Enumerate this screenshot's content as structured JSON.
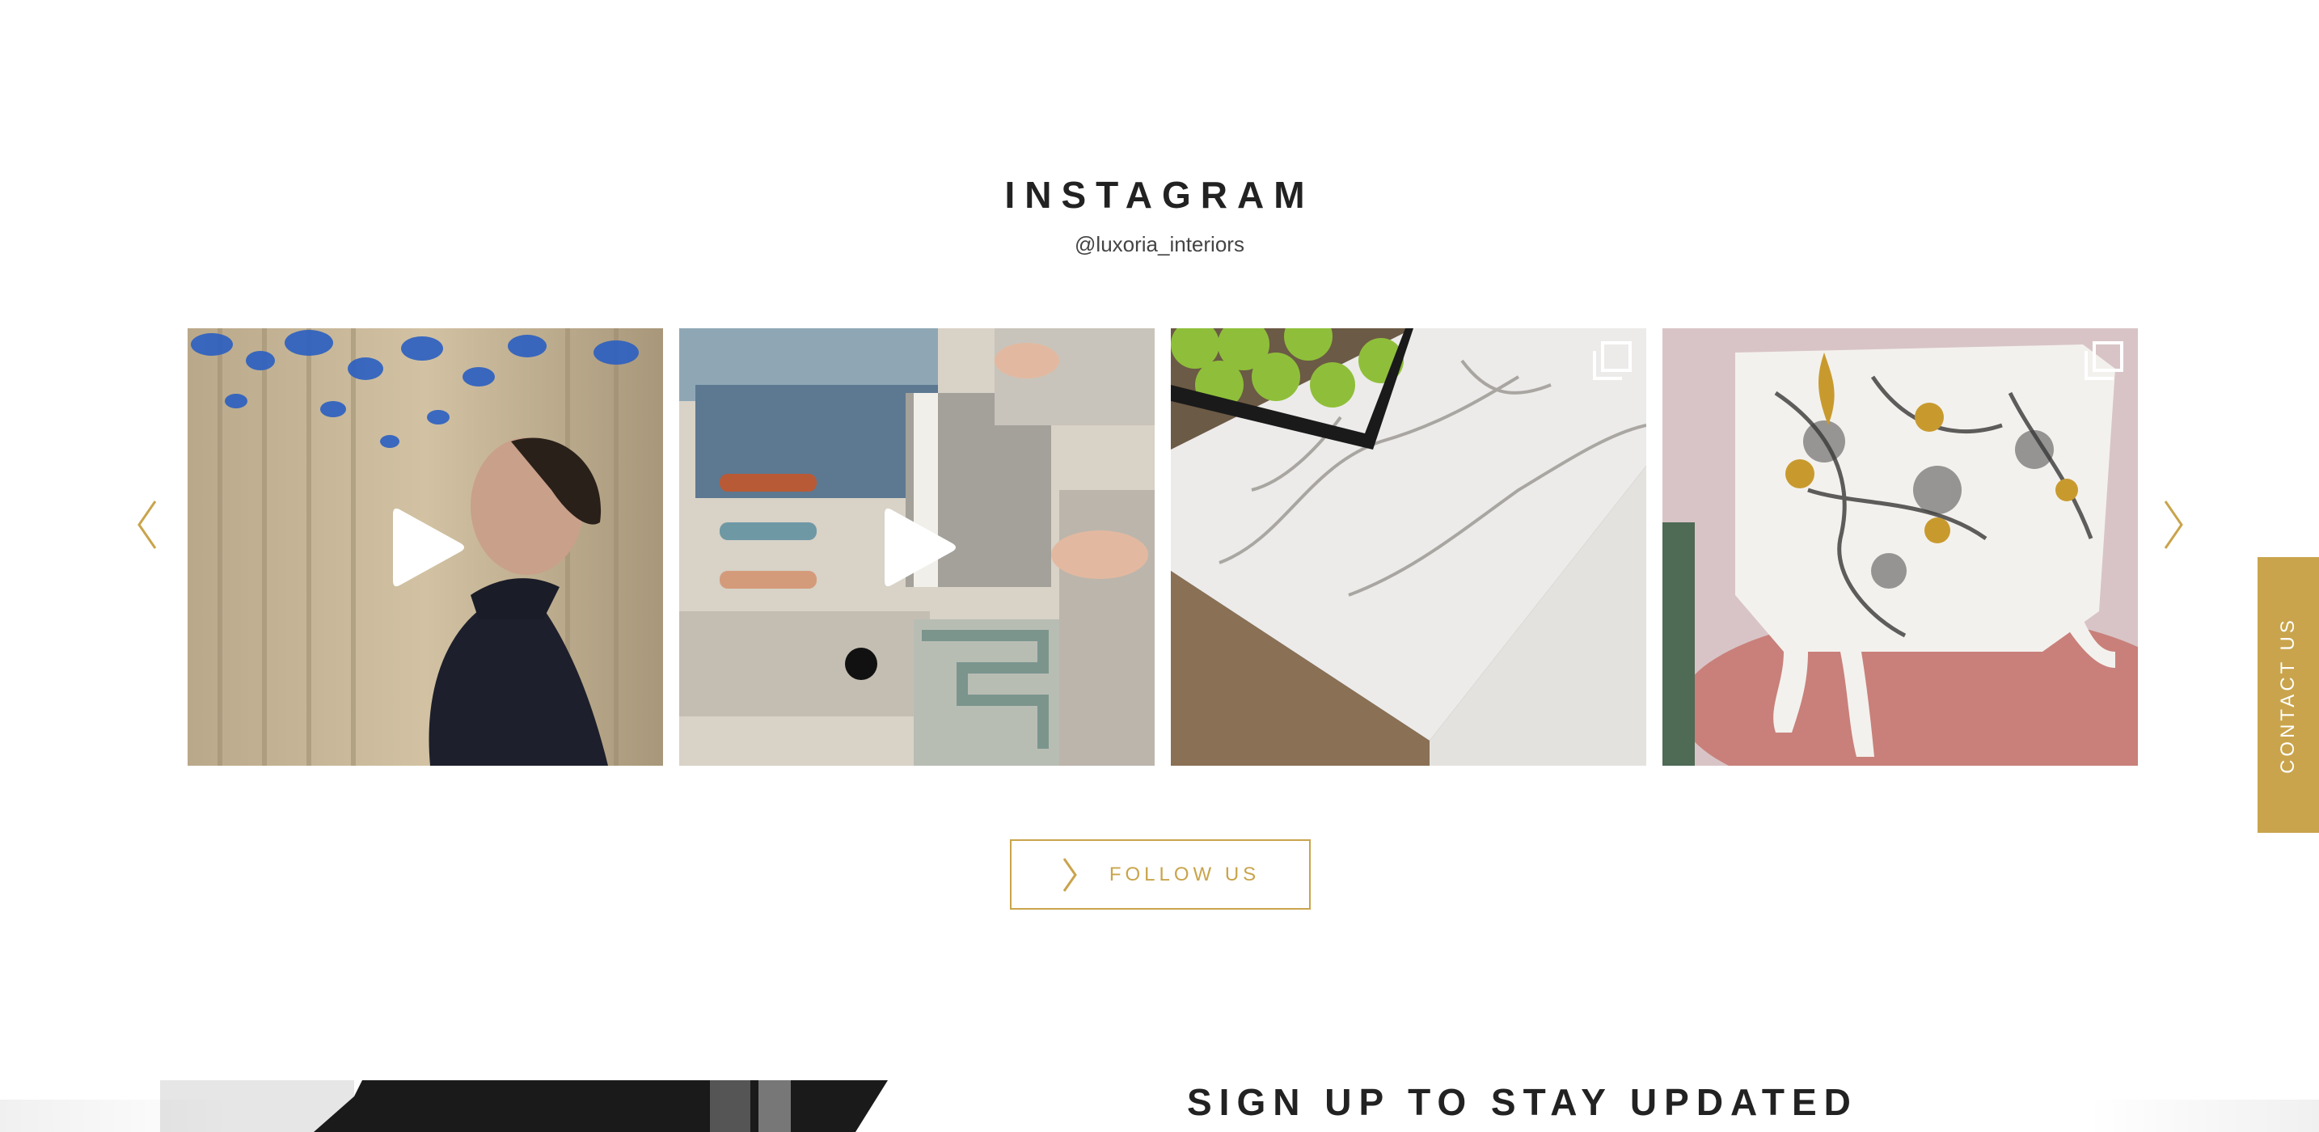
{
  "instagram": {
    "title": "INSTAGRAM",
    "handle": "@luxoria_interiors",
    "posts": [
      {
        "type": "video",
        "subject": "man looking up at blue glass chandelier"
      },
      {
        "type": "video",
        "subject": "fabric and material samples moodboard"
      },
      {
        "type": "carousel",
        "subject": "white marble countertop with lime bowl"
      },
      {
        "type": "carousel",
        "subject": "chinoiserie painted commode"
      }
    ],
    "follow_label": "FOLLOW US"
  },
  "navigation": {
    "prev_icon": "chevron-left-icon",
    "next_icon": "chevron-right-icon"
  },
  "contact": {
    "label": "CONTACT US"
  },
  "signup": {
    "title": "SIGN UP TO STAY UPDATED"
  },
  "colors": {
    "accent": "#c9a44c",
    "text": "#222222",
    "background": "#ffffff"
  }
}
